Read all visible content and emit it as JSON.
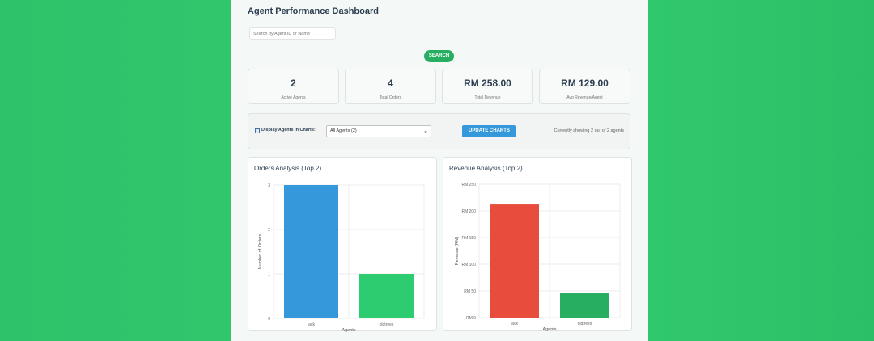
{
  "page": {
    "title": "Agent Performance Dashboard",
    "search_placeholder": "Search by Agent ID or Name",
    "search_button": "SEARCH"
  },
  "stats": [
    {
      "value": "2",
      "label": "Active Agents"
    },
    {
      "value": "4",
      "label": "Total Orders"
    },
    {
      "value": "RM 258.00",
      "label": "Total Revenue"
    },
    {
      "value": "RM 129.00",
      "label": "Avg Revenue/Agent"
    }
  ],
  "controls": {
    "checkbox_label": "Display Agents in Charts:",
    "checkbox_checked": true,
    "select_value": "All Agents (2)",
    "update_button": "UPDATE CHARTS",
    "showing_text": "Currently showing 2 out of 2 agents"
  },
  "colors": {
    "background": "#2fc46b",
    "search_button": "#27ae60",
    "update_button": "#3498db",
    "orders_bar_1": "#3498db",
    "orders_bar_2": "#2ecc71",
    "revenue_bar_1": "#e74c3c",
    "revenue_bar_2": "#27ae60"
  },
  "chart_data": [
    {
      "type": "bar",
      "title": "Orders Analysis (Top 2)",
      "categories": [
        "jack",
        "oldtrees"
      ],
      "values": [
        3,
        1
      ],
      "xlabel": "Agents",
      "ylabel": "Number of Orders",
      "ylim": [
        0,
        3
      ],
      "yticks": [
        "0",
        "1",
        "2",
        "3"
      ],
      "grid": true
    },
    {
      "type": "bar",
      "title": "Revenue Analysis (Top 2)",
      "categories": [
        "jack",
        "oldtrees"
      ],
      "values": [
        212,
        46
      ],
      "xlabel": "Agents",
      "ylabel": "Revenue (RM)",
      "ylim": [
        0,
        250
      ],
      "yticks": [
        "RM 0",
        "RM 50",
        "RM 100",
        "RM 150",
        "RM 200",
        "RM 250"
      ],
      "grid": true
    }
  ]
}
